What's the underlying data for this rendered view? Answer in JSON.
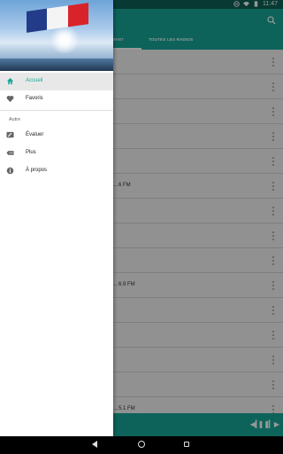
{
  "status_bar": {
    "time": "11:47"
  },
  "app": {
    "tabs": [
      {
        "label": "…ÉNEMENT"
      },
      {
        "label": "TOUTES LES RADIOS"
      }
    ],
    "rows": [
      {
        "label": ""
      },
      {
        "label": ""
      },
      {
        "label": ""
      },
      {
        "label": ""
      },
      {
        "label": ""
      },
      {
        "label": "…6 FM"
      },
      {
        "label": ""
      },
      {
        "label": ""
      },
      {
        "label": ""
      },
      {
        "label": "…6.9 FM"
      },
      {
        "label": ""
      },
      {
        "label": ""
      },
      {
        "label": ""
      },
      {
        "label": ""
      },
      {
        "label": "…5.1 FM"
      }
    ]
  },
  "drawer": {
    "items": [
      {
        "label": "Accueil",
        "icon": "home-icon",
        "active": true
      },
      {
        "label": "Favoris",
        "icon": "heart-icon",
        "active": false
      }
    ],
    "section_title": "Autre",
    "other_items": [
      {
        "label": "Évaluer",
        "icon": "rate-icon"
      },
      {
        "label": "Plus",
        "icon": "more-apps-icon"
      },
      {
        "label": "À propos",
        "icon": "info-icon"
      }
    ]
  },
  "colors": {
    "accent": "#17a697",
    "status_bar": "#0e5f55"
  }
}
